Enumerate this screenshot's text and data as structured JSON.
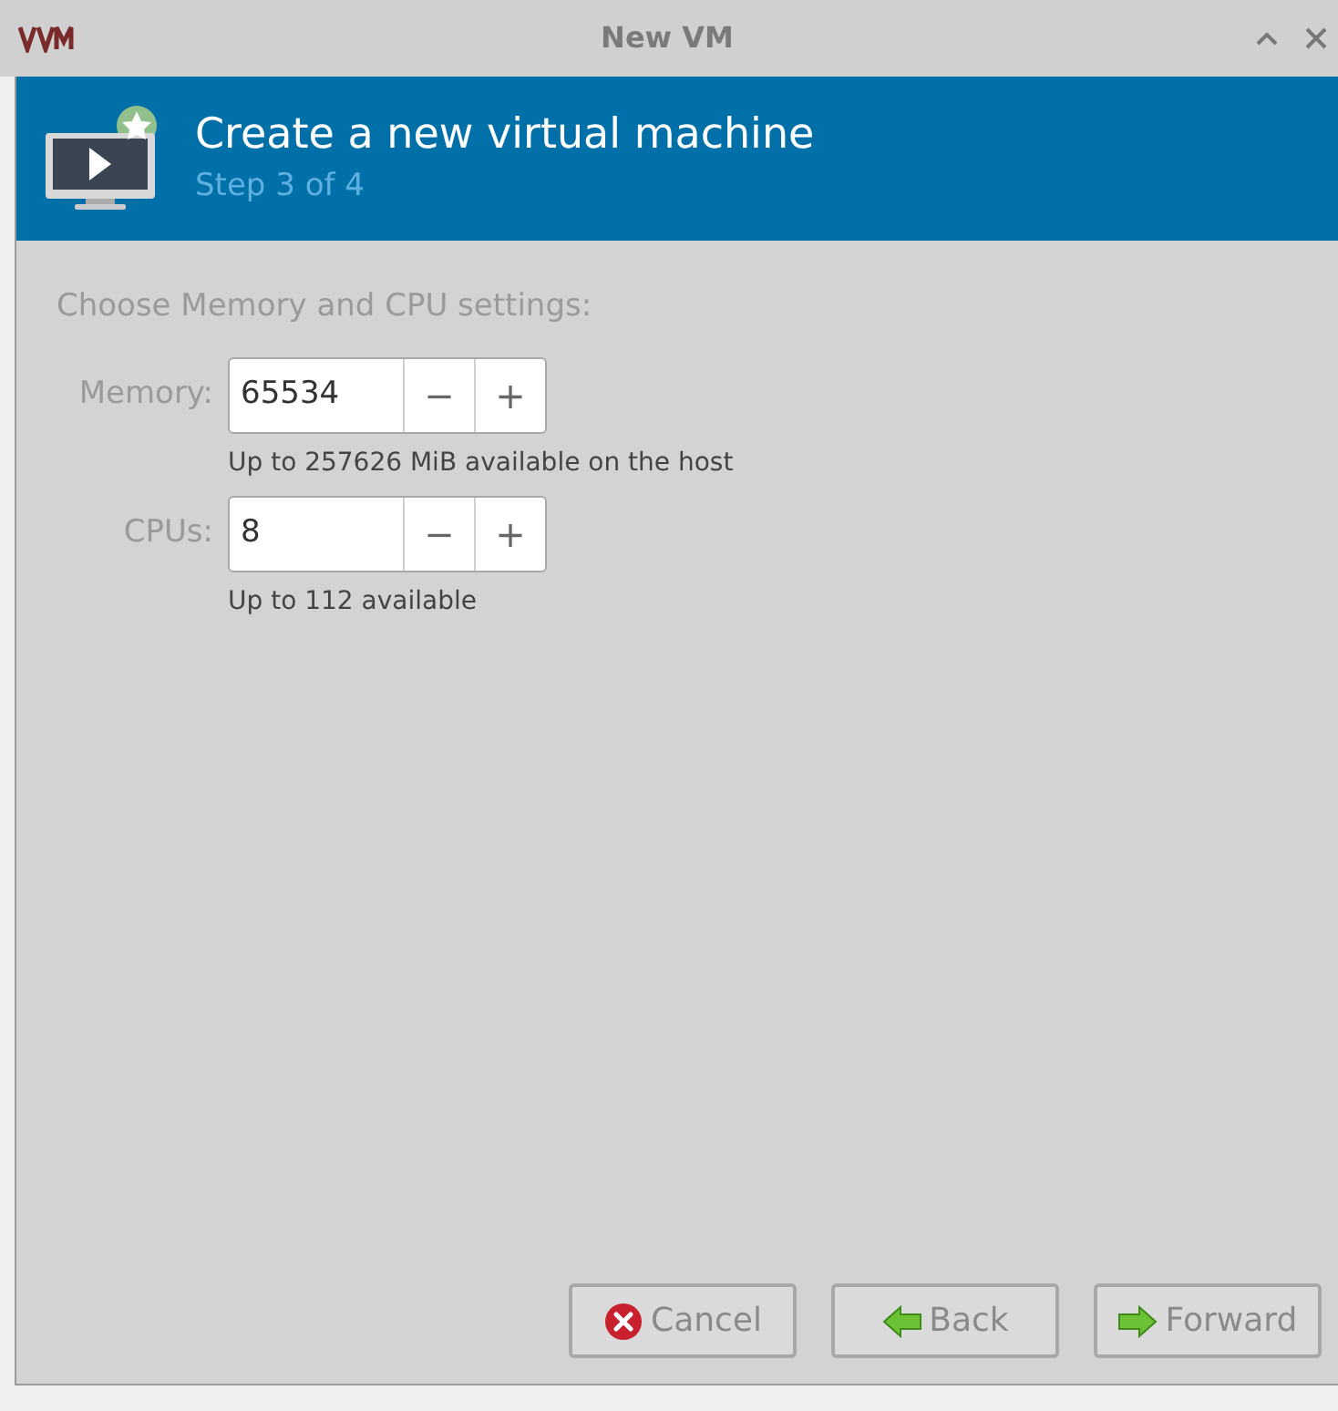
{
  "window": {
    "title": "New VM"
  },
  "header": {
    "title": "Create a new virtual machine",
    "subtitle": "Step 3 of 4"
  },
  "section_label": "Choose Memory and CPU settings:",
  "fields": [
    {
      "label": "Memory:",
      "value": "65534",
      "decrement": "−",
      "increment": "+",
      "hint": "Up to 257626 MiB available on the host"
    },
    {
      "label": "CPUs:",
      "value": "8",
      "decrement": "−",
      "increment": "+",
      "hint": "Up to 112 available"
    }
  ],
  "buttons": [
    {
      "kind": "cancel",
      "label": "Cancel"
    },
    {
      "kind": "back",
      "label": "Back"
    },
    {
      "kind": "forward",
      "label": "Forward"
    }
  ]
}
